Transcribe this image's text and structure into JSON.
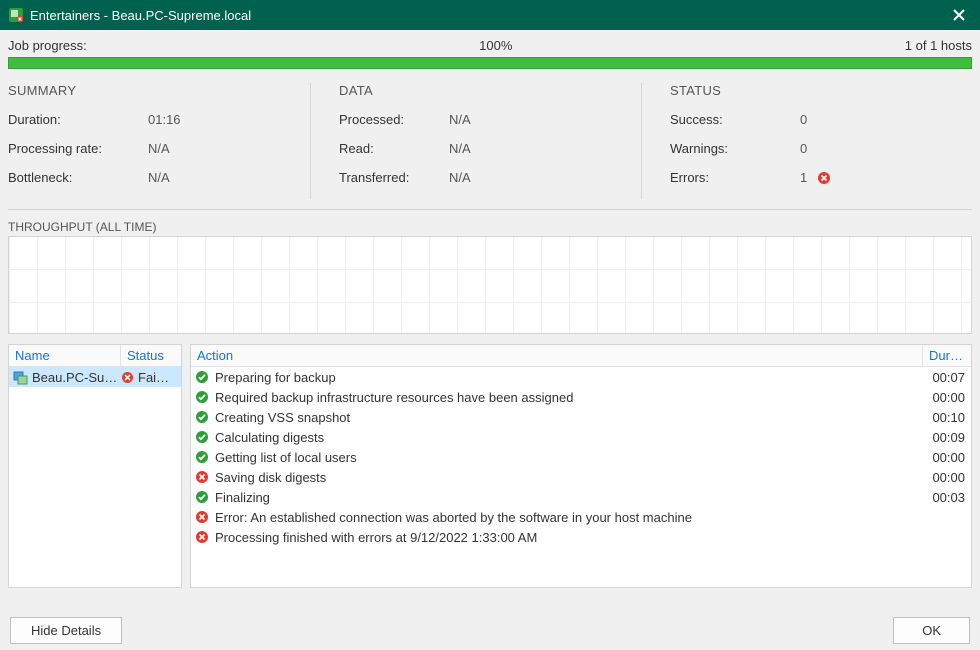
{
  "title": "Entertainers - Beau.PC-Supreme.local",
  "progress": {
    "label": "Job progress:",
    "percent": "100%",
    "hosts": "1 of 1 hosts"
  },
  "summary": {
    "head": "SUMMARY",
    "duration_label": "Duration:",
    "duration": "01:16",
    "rate_label": "Processing rate:",
    "rate": "N/A",
    "bottleneck_label": "Bottleneck:",
    "bottleneck": "N/A"
  },
  "data": {
    "head": "DATA",
    "processed_label": "Processed:",
    "processed": "N/A",
    "read_label": "Read:",
    "read": "N/A",
    "transferred_label": "Transferred:",
    "transferred": "N/A"
  },
  "status": {
    "head": "STATUS",
    "success_label": "Success:",
    "success": "0",
    "warnings_label": "Warnings:",
    "warnings": "0",
    "errors_label": "Errors:",
    "errors": "1"
  },
  "throughput_label": "THROUGHPUT (ALL TIME)",
  "hosts": {
    "col_name": "Name",
    "col_status": "Status",
    "row": {
      "name": "Beau.PC-Sup…",
      "status": "Fai…"
    }
  },
  "actions": {
    "col_action": "Action",
    "col_dura": "Dura…",
    "rows": [
      {
        "icon": "ok",
        "text": "Preparing for backup",
        "dura": "00:07"
      },
      {
        "icon": "ok",
        "text": "Required backup infrastructure resources have been assigned",
        "dura": "00:00"
      },
      {
        "icon": "ok",
        "text": "Creating VSS snapshot",
        "dura": "00:10"
      },
      {
        "icon": "ok",
        "text": "Calculating digests",
        "dura": "00:09"
      },
      {
        "icon": "ok",
        "text": "Getting list of local users",
        "dura": "00:00"
      },
      {
        "icon": "err",
        "text": "Saving disk digests",
        "dura": "00:00"
      },
      {
        "icon": "ok",
        "text": "Finalizing",
        "dura": "00:03"
      },
      {
        "icon": "err",
        "text": "Error: An established connection was aborted by the software in your host machine",
        "dura": ""
      },
      {
        "icon": "err",
        "text": "Processing finished with errors at 9/12/2022 1:33:00 AM",
        "dura": ""
      }
    ]
  },
  "footer": {
    "hide": "Hide Details",
    "ok": "OK"
  },
  "icons": {
    "ok": "ok-icon",
    "err": "error-icon",
    "host": "host-icon"
  },
  "colors": {
    "titlebar": "#00614e",
    "progress": "#3fbd3f",
    "link": "#1a73c7",
    "error": "#e03b2e",
    "ok": "#2e9e3a"
  }
}
